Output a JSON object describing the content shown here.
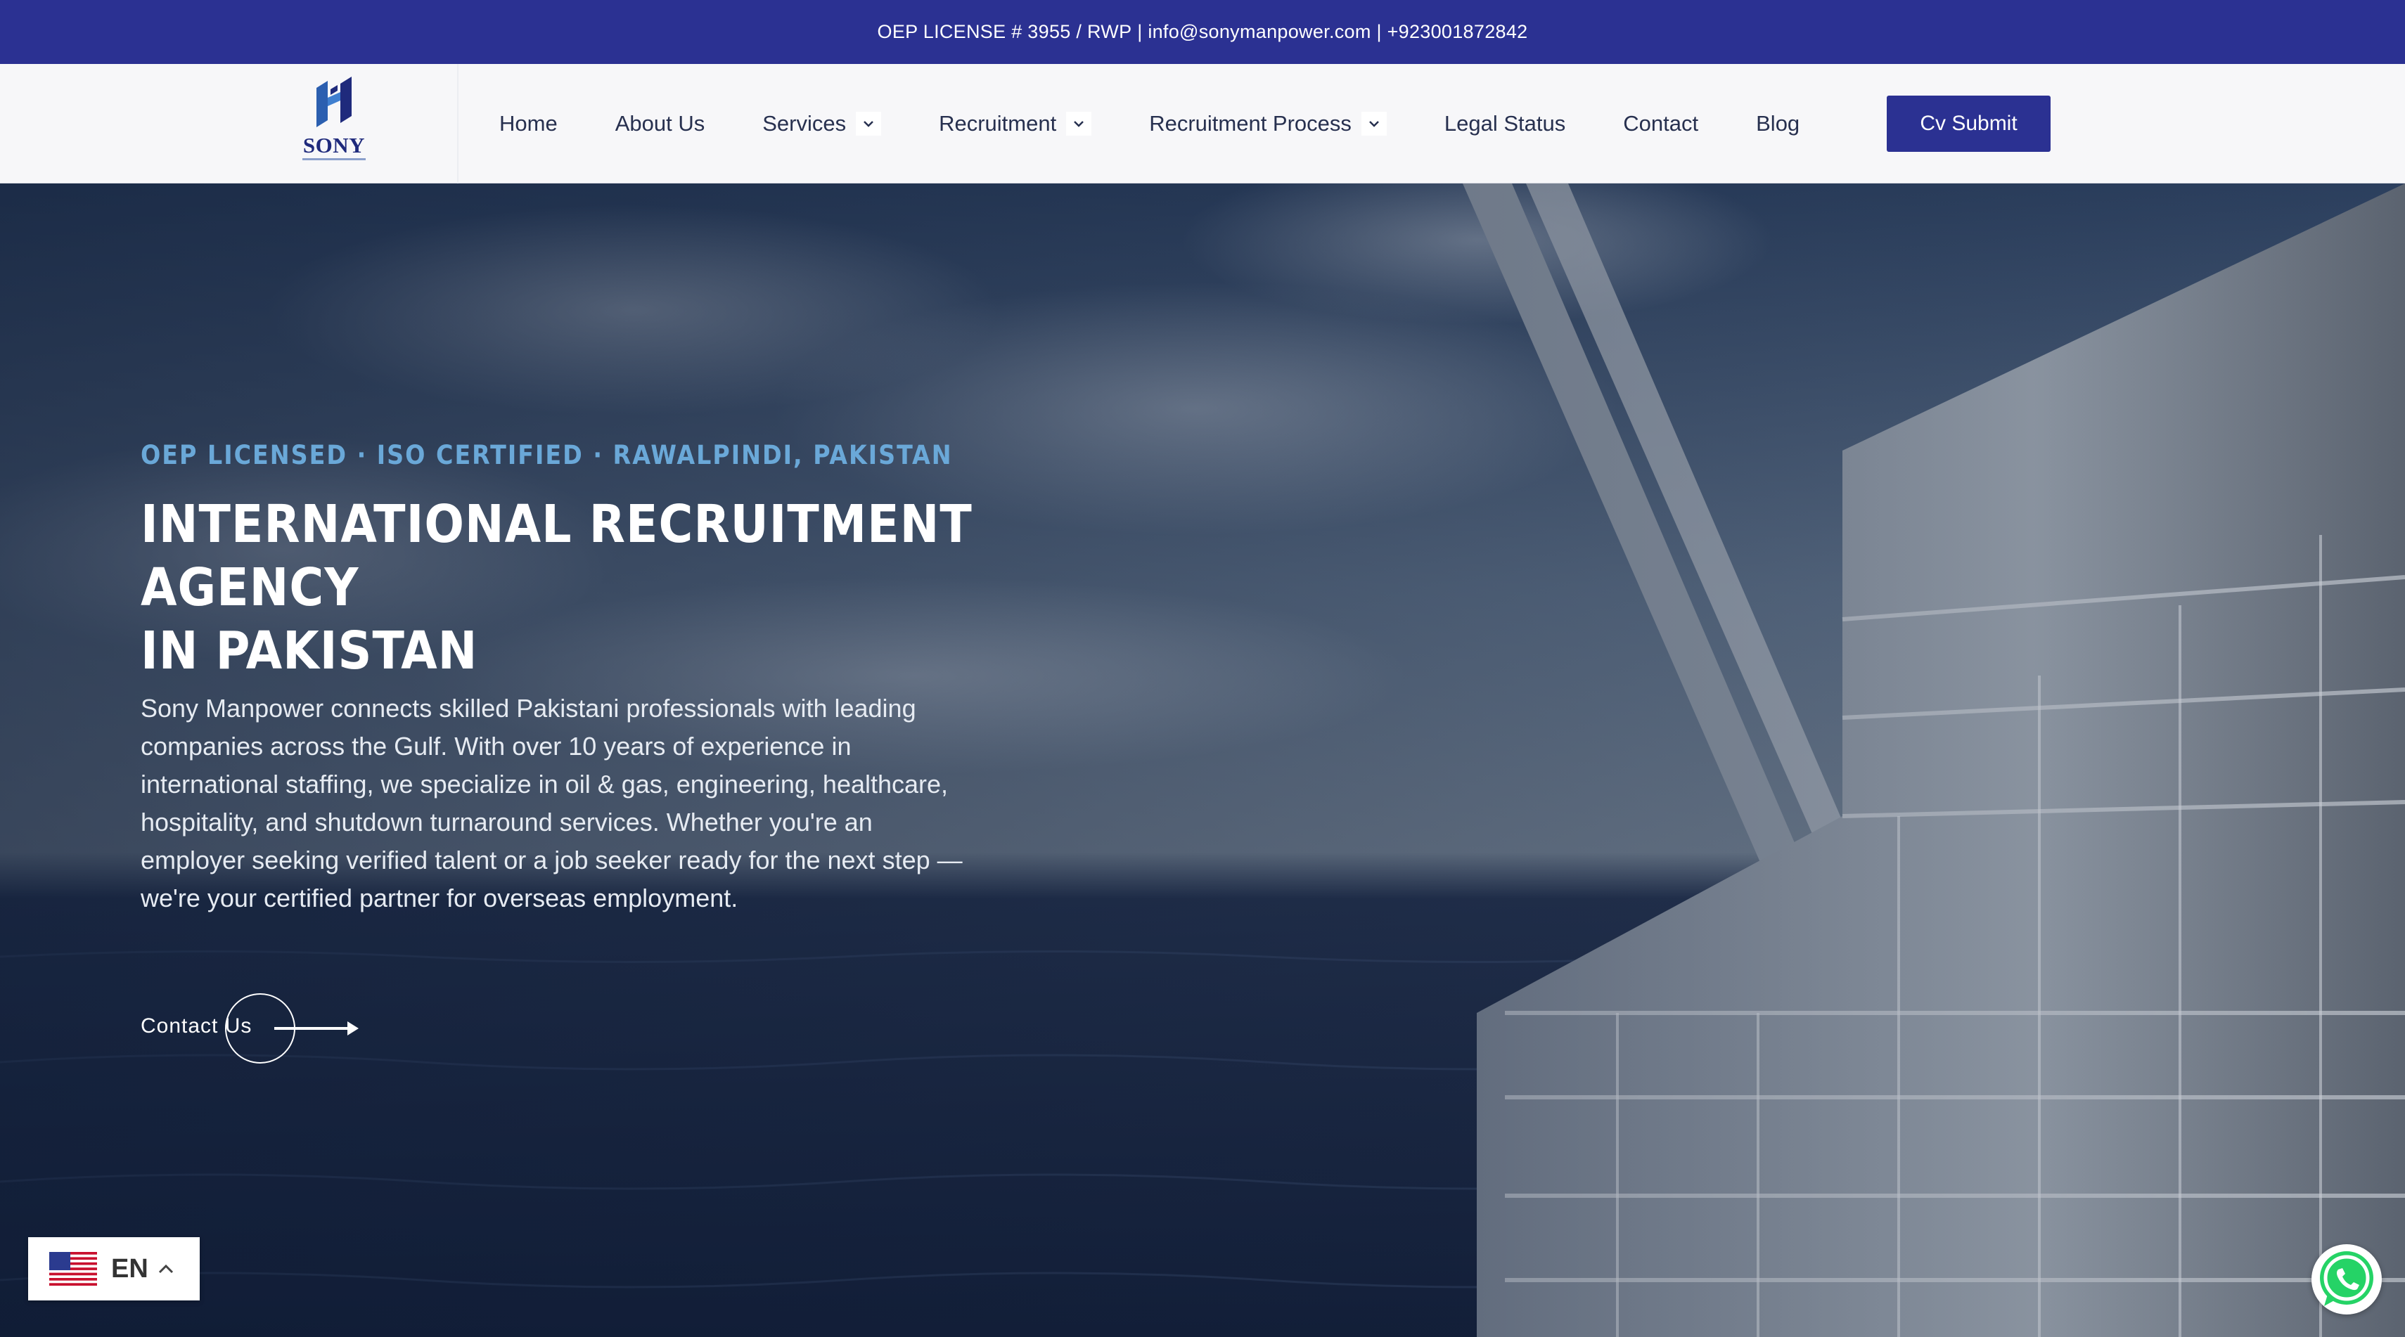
{
  "topbar": {
    "license": "OEP LICENSE # 3955 / RWP",
    "email": "info@sonymanpower.com",
    "phone": "+923001872842"
  },
  "logo": {
    "text": "SONY"
  },
  "nav": {
    "items": [
      {
        "label": "Home",
        "dropdown": false
      },
      {
        "label": "About Us",
        "dropdown": false
      },
      {
        "label": "Services",
        "dropdown": true
      },
      {
        "label": "Recruitment",
        "dropdown": true
      },
      {
        "label": "Recruitment Process",
        "dropdown": true
      },
      {
        "label": "Legal Status",
        "dropdown": false
      },
      {
        "label": "Contact",
        "dropdown": false
      },
      {
        "label": "Blog",
        "dropdown": false
      }
    ],
    "cta_label": "Cv Submit"
  },
  "hero": {
    "eyebrow": "OEP LICENSED · ISO CERTIFIED · RAWALPINDI, PAKISTAN",
    "title_line1": "INTERNATIONAL RECRUITMENT AGENCY",
    "title_line2": "IN PAKISTAN",
    "description": "Sony Manpower connects skilled Pakistani professionals with leading companies across the Gulf. With over 10 years of experience in international staffing, we specialize in oil & gas, engineering, healthcare, hospitality, and shutdown turnaround services. Whether you're an employer seeking verified talent or a job seeker ready for the next step — we're your certified partner for overseas employment.",
    "cta_label": "Contact Us"
  },
  "language": {
    "code": "EN",
    "flag_icon": "us-flag-icon"
  },
  "colors": {
    "brand": "#2b3192",
    "eyebrow": "#6aa8d8"
  }
}
